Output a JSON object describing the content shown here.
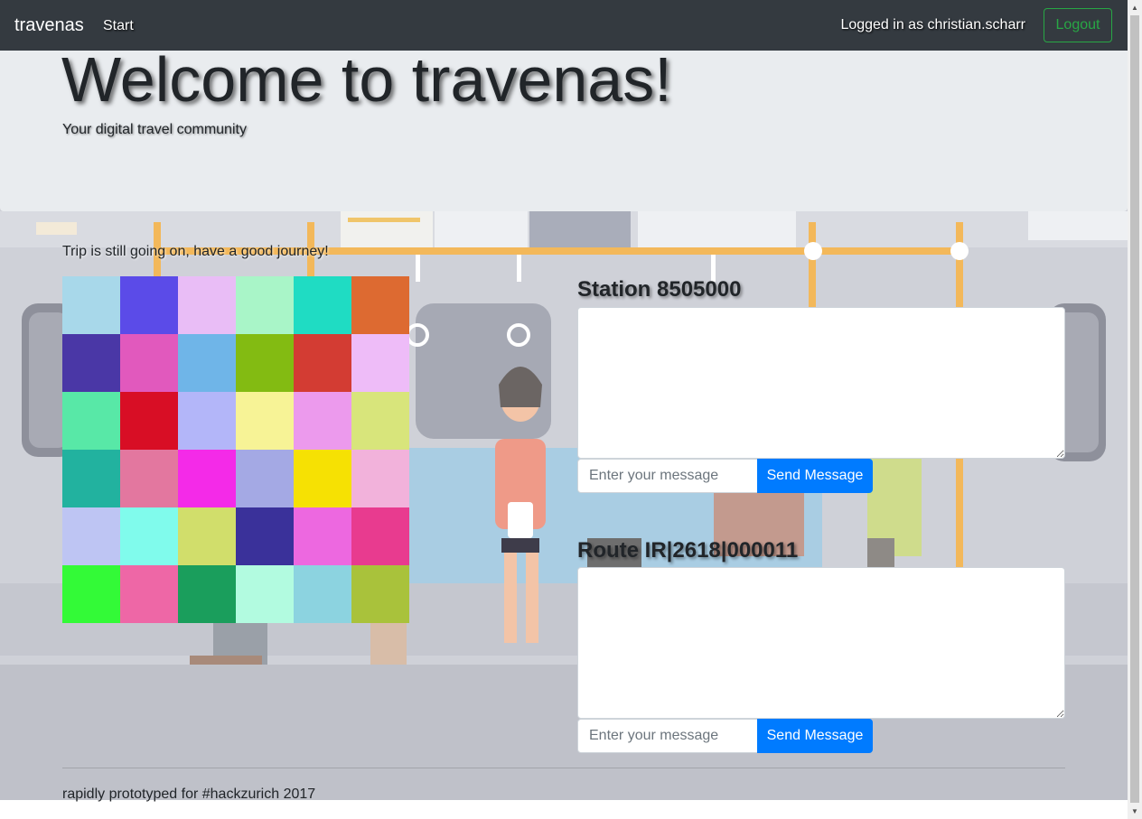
{
  "navbar": {
    "brand": "travenas",
    "start_link": "Start",
    "logged_in_text": "Logged in as christian.scharr",
    "logout_label": "Logout"
  },
  "jumbotron": {
    "title": "Welcome to travenas!",
    "subtitle": "Your digital travel community"
  },
  "trip_status": "Trip is still going on, have a good journey!",
  "mosaic_colors": [
    [
      "#a8d8ea",
      "#5b4be8",
      "#e9bdf6",
      "#a9f5c8",
      "#1fdcc3",
      "#dd6a31"
    ],
    [
      "#4a37a6",
      "#e159bd",
      "#6fb5e8",
      "#83bb12",
      "#d33c33",
      "#eebcf8"
    ],
    [
      "#58e8a7",
      "#d80e25",
      "#b3b6f9",
      "#f7f396",
      "#ec9aed",
      "#d8e57b"
    ],
    [
      "#22b29f",
      "#e3779f",
      "#f42ae8",
      "#a4a9e4",
      "#f6e103",
      "#f2b2db"
    ],
    [
      "#bec5f3",
      "#80fbec",
      "#d1de6b",
      "#3a319a",
      "#ed68e0",
      "#e83b8f"
    ],
    [
      "#33fa37",
      "#ee67a6",
      "#1a9e5c",
      "#b2fbe0",
      "#8cd3e0",
      "#a9c23b"
    ]
  ],
  "station_chat": {
    "title": "Station 8505000",
    "input_placeholder": "Enter your message",
    "send_label": "Send Message"
  },
  "route_chat": {
    "title": "Route IR|2618|000011",
    "input_placeholder": "Enter your message",
    "send_label": "Send Message"
  },
  "footer": {
    "text": "rapidly prototyped for #hackzurich 2017"
  }
}
